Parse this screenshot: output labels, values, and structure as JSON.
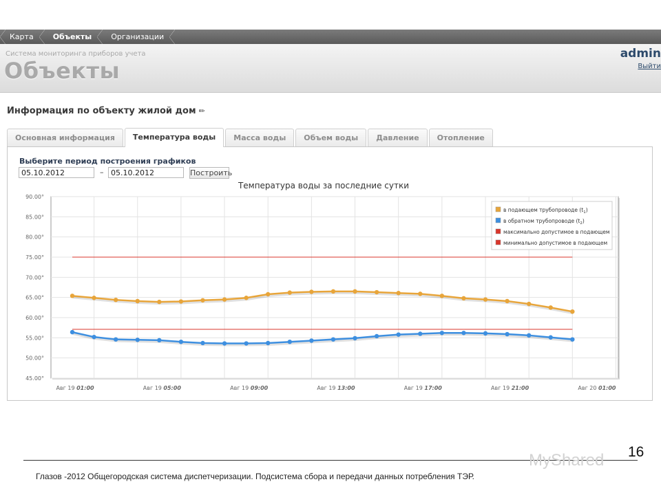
{
  "nav": {
    "items": [
      {
        "label": "Карта",
        "active": false
      },
      {
        "label": "Объекты",
        "active": true
      },
      {
        "label": "Организации",
        "active": false
      }
    ]
  },
  "header": {
    "subtitle": "Система мониторинга приборов учета",
    "title": "Объекты",
    "user": "admin",
    "logout": "Выйти"
  },
  "section": {
    "title": "Информация по объекту жилой дом",
    "edit_icon": "pencil-icon"
  },
  "tabs": [
    {
      "label": "Основная информация",
      "active": false
    },
    {
      "label": "Температура воды",
      "active": true
    },
    {
      "label": "Масса воды",
      "active": false
    },
    {
      "label": "Объем воды",
      "active": false
    },
    {
      "label": "Давление",
      "active": false
    },
    {
      "label": "Отопление",
      "active": false
    }
  ],
  "period": {
    "label": "Выберите период построения графиков",
    "from": "05.10.2012",
    "separator": "–",
    "to": "05.10.2012",
    "button": "Построить"
  },
  "chart_data": {
    "type": "line",
    "title": "Температура воды за последние сутки",
    "ylim": [
      45,
      90
    ],
    "yticks": [
      "90.00°",
      "85.00°",
      "80.00°",
      "75.00°",
      "70.00°",
      "65.00°",
      "60.00°",
      "55.00°",
      "50.00°",
      "45.00°"
    ],
    "ytick_values": [
      90,
      85,
      80,
      75,
      70,
      65,
      60,
      55,
      50,
      45
    ],
    "xlim": [
      0,
      25
    ],
    "xticks": [
      {
        "x": 1,
        "date": "Авг 19",
        "time": "01:00"
      },
      {
        "x": 5,
        "date": "Авг 19",
        "time": "05:00"
      },
      {
        "x": 9,
        "date": "Авг 19",
        "time": "09:00"
      },
      {
        "x": 13,
        "date": "Авг 19",
        "time": "13:00"
      },
      {
        "x": 17,
        "date": "Авг 19",
        "time": "17:00"
      },
      {
        "x": 21,
        "date": "Авг 19",
        "time": "21:00"
      },
      {
        "x": 25,
        "date": "Авг 20",
        "time": "01:00"
      }
    ],
    "grid": true,
    "legend_position": "top-right",
    "series": [
      {
        "name": "в подающем трубопроводе (t",
        "sub": "1",
        "suffix": ")",
        "color": "#e8a53a",
        "markers": true,
        "x": [
          0,
          1,
          2,
          3,
          4,
          5,
          6,
          7,
          8,
          9,
          10,
          11,
          12,
          13,
          14,
          15,
          16,
          17,
          18,
          19,
          20,
          21,
          22,
          23
        ],
        "values": [
          65.4,
          64.9,
          64.4,
          64.1,
          63.9,
          64.0,
          64.3,
          64.5,
          64.9,
          65.8,
          66.2,
          66.4,
          66.5,
          66.5,
          66.3,
          66.1,
          65.9,
          65.4,
          64.8,
          64.5,
          64.1,
          63.4,
          62.5,
          61.5
        ]
      },
      {
        "name": "в обратном трубопроводе (t",
        "sub": "2",
        "suffix": ")",
        "color": "#3d8fe0",
        "markers": true,
        "x": [
          0,
          1,
          2,
          3,
          4,
          5,
          6,
          7,
          8,
          9,
          10,
          11,
          12,
          13,
          14,
          15,
          16,
          17,
          18,
          19,
          20,
          21,
          22,
          23
        ],
        "values": [
          56.4,
          55.2,
          54.6,
          54.5,
          54.4,
          54.0,
          53.7,
          53.6,
          53.6,
          53.7,
          54.0,
          54.3,
          54.6,
          54.9,
          55.4,
          55.8,
          56.0,
          56.2,
          56.2,
          56.1,
          55.9,
          55.6,
          55.1,
          54.6
        ]
      },
      {
        "name": "максимально допустимое в подающем",
        "color": "#d9352b",
        "markers": false,
        "x": [
          0,
          23
        ],
        "values": [
          75,
          75
        ]
      },
      {
        "name": "минимально допустимое в подающем",
        "color": "#d9352b",
        "markers": false,
        "x": [
          0,
          23
        ],
        "values": [
          57.1,
          57.1
        ]
      }
    ]
  },
  "footer": {
    "text": "Глазов -2012 Общегородская система диспетчеризации. Подсистема сбора и передачи данных потребления ТЭР.",
    "slide": "16",
    "watermark": "MyShared"
  }
}
